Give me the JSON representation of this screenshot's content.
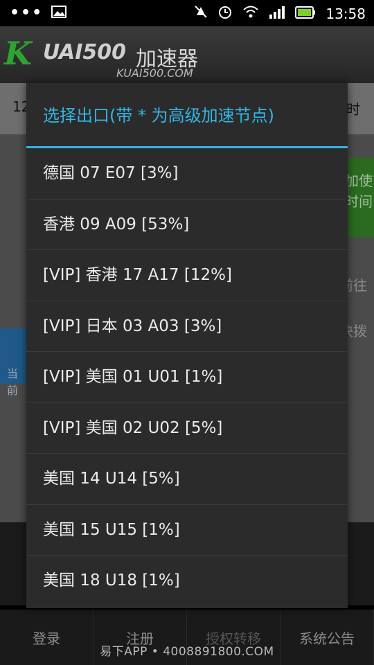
{
  "status_bar": {
    "time": "13:58",
    "icons": [
      "more-dots-icon",
      "image-icon",
      "mute-icon",
      "alarm-icon",
      "wifi-icon",
      "signal-icon",
      "battery-icon"
    ]
  },
  "header": {
    "logo_k": "K",
    "logo_word": "UAI500",
    "logo_cn": "加速器",
    "logo_url": "KUAI500.COM"
  },
  "background": {
    "row_left": "12",
    "row_right": "时",
    "green_text_1": "加使",
    "green_text_2": "时间",
    "side_text_1": "前往",
    "side_text_2": "快拨",
    "blue_text": "当前"
  },
  "dialog": {
    "title": "选择出口(带 * 为高级加速节点)",
    "items": [
      "德国 07 E07 [3%]",
      "香港 09 A09 [53%]",
      "[VIP] 香港 17 A17 [12%]",
      "[VIP] 日本 03 A03 [3%]",
      "[VIP] 美国 01 U01 [1%]",
      "[VIP] 美国 02 U02 [5%]",
      "美国 14 U14 [5%]",
      "美国 15 U15 [1%]",
      "美国 18 U18 [1%]"
    ]
  },
  "bottom_nav": {
    "login": "登录",
    "register": "注册",
    "transfer": "授权转移",
    "notice": "系统公告"
  },
  "watermark": "易下APP • 4008891800.COM",
  "colors": {
    "accent": "#33b5e5",
    "dialog_bg": "#2b2b2b"
  }
}
